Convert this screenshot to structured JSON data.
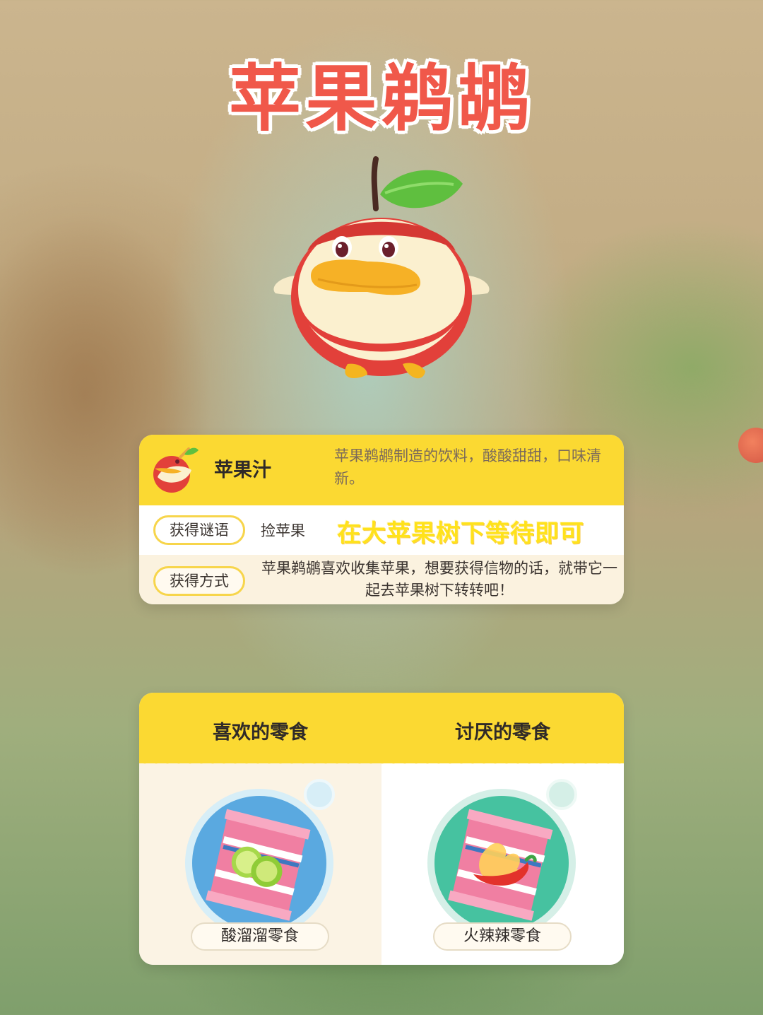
{
  "title": "苹果鹈鹕",
  "item": {
    "name": "苹果汁",
    "description": "苹果鹈鹕制造的饮料，酸酸甜甜，口味清新。"
  },
  "riddle": {
    "label": "获得谜语",
    "value": "捡苹果",
    "hint": "在大苹果树下等待即可"
  },
  "method": {
    "label": "获得方式",
    "value": "苹果鹈鹕喜欢收集苹果，想要获得信物的话，就带它一起去苹果树下转转吧！"
  },
  "snacks": {
    "liked_title": "喜欢的零食",
    "disliked_title": "讨厌的零食",
    "liked": {
      "name": "酸溜溜零食",
      "icon": "lime-snack-bag-icon",
      "color": "#5aa9e0"
    },
    "disliked": {
      "name": "火辣辣零食",
      "icon": "chili-snack-bag-icon",
      "color": "#46c2a0"
    }
  },
  "colors": {
    "title": "#f0584a",
    "panel_header": "#fbd932",
    "hint": "#ffe21b"
  }
}
